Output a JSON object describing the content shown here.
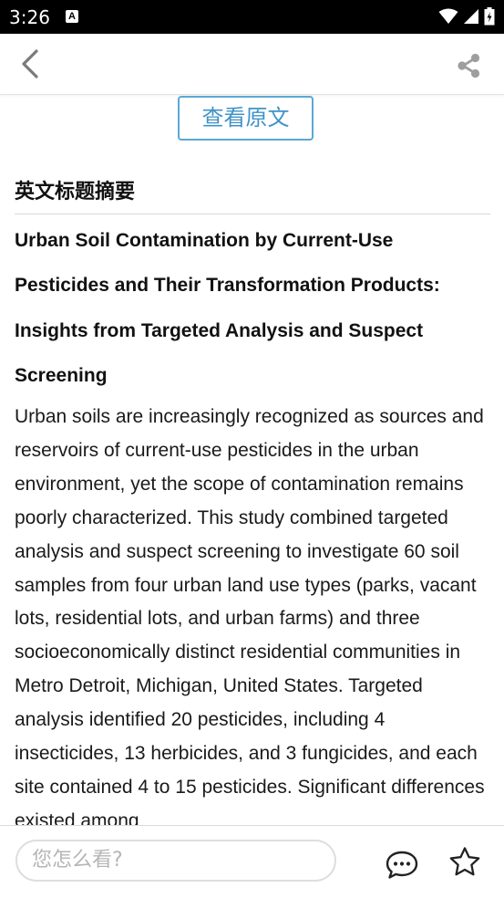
{
  "status_bar": {
    "time": "3:26",
    "notification_icon": "A",
    "icons": [
      "wifi-icon",
      "signal-icon",
      "battery-icon"
    ]
  },
  "toolbar": {
    "back_icon": "back-chevron-icon",
    "share_icon": "share-icon"
  },
  "content": {
    "view_original_label": "查看原文",
    "section_heading": "英文标题摘要",
    "title": "Urban Soil Contamination by Current-Use Pesticides and Their Transformation Products: Insights from Targeted Analysis and Suspect Screening",
    "abstract": "Urban soils are increasingly recognized as sources and reservoirs of current-use pesticides in the urban environment, yet the scope of contamination remains poorly characterized. This study combined targeted analysis and suspect screening to investigate 60 soil samples from four urban land use types (parks, vacant lots, residential lots, and urban farms) and three socioeconomically distinct residential communities in Metro Detroit, Michigan, United States. Targeted analysis identified 20 pesticides, including 4 insecticides, 13 herbicides, and 3 fungicides, and each site contained 4 to 15 pesticides. Significant differences existed among"
  },
  "bottom_bar": {
    "comment_placeholder": "您怎么看?",
    "comment_icon": "comment-icon",
    "favorite_icon": "star-icon"
  },
  "colors": {
    "accent": "#3f93c7",
    "status_bar_bg": "#000000",
    "icon_gray": "#9e9e9e"
  }
}
